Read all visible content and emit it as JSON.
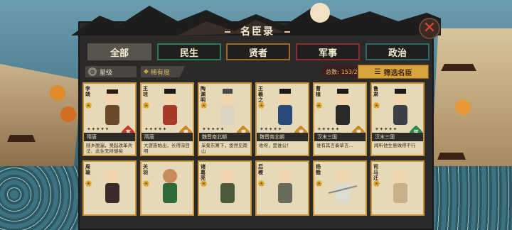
{
  "title": "名臣录",
  "close_icon": "close-x-icon",
  "tabs": [
    {
      "label": "全部",
      "active": true,
      "border": "#57534d"
    },
    {
      "label": "民生",
      "active": false,
      "border": "#2e7a5a"
    },
    {
      "label": "贤者",
      "active": false,
      "border": "#9a6a2a"
    },
    {
      "label": "军事",
      "active": false,
      "border": "#8a2e2a"
    },
    {
      "label": "政治",
      "active": false,
      "border": "#2a6a6a"
    }
  ],
  "filters": {
    "star_label": "星级",
    "sort_label": "稀有度",
    "count_label": "总数:",
    "count_value": "153/262",
    "filter_button": "筛选名臣"
  },
  "cards_row1": [
    {
      "name": "李靖",
      "era": "隋唐",
      "desc": "随乡脱漏，吴起改革兵法、此生无所憾矣",
      "badge": "军",
      "badge_color": "#c23a2e",
      "star": "天"
    },
    {
      "name": "王珪",
      "era": "隋唐",
      "desc": "大游族始出，长得深目明",
      "badge": "贤",
      "badge_color": "#c98a2a",
      "star": "天"
    },
    {
      "name": "陶渊明",
      "era": "魏晋南北朝",
      "desc": "采菊东篱下，悠然见南山",
      "badge": "贤",
      "badge_color": "#c98a2a",
      "star": "天"
    },
    {
      "name": "王羲之",
      "era": "魏晋南北朝",
      "desc": "收呀，是谁公！",
      "badge": "贤",
      "badge_color": "#c98a2a",
      "star": "天"
    },
    {
      "name": "曹植",
      "era": "汉末三国",
      "desc": "谁有其言奏草言...",
      "badge": "贤",
      "badge_color": "#c98a2a",
      "star": "天"
    },
    {
      "name": "鲁肃",
      "era": "汉末三国",
      "desc": "闻听他生意做得不行",
      "badge": "民",
      "badge_color": "#2f8a4a",
      "star": "天"
    }
  ],
  "cards_row2": [
    {
      "name": "周瑜",
      "star": "天"
    },
    {
      "name": "关羽",
      "star": "天"
    },
    {
      "name": "诸葛亮",
      "star": "天"
    },
    {
      "name": "后稷",
      "star": "天"
    },
    {
      "name": "杨戬",
      "star": "天"
    },
    {
      "name": "司马迁",
      "star": "天"
    }
  ],
  "gems": "✦✦✦✦✦"
}
